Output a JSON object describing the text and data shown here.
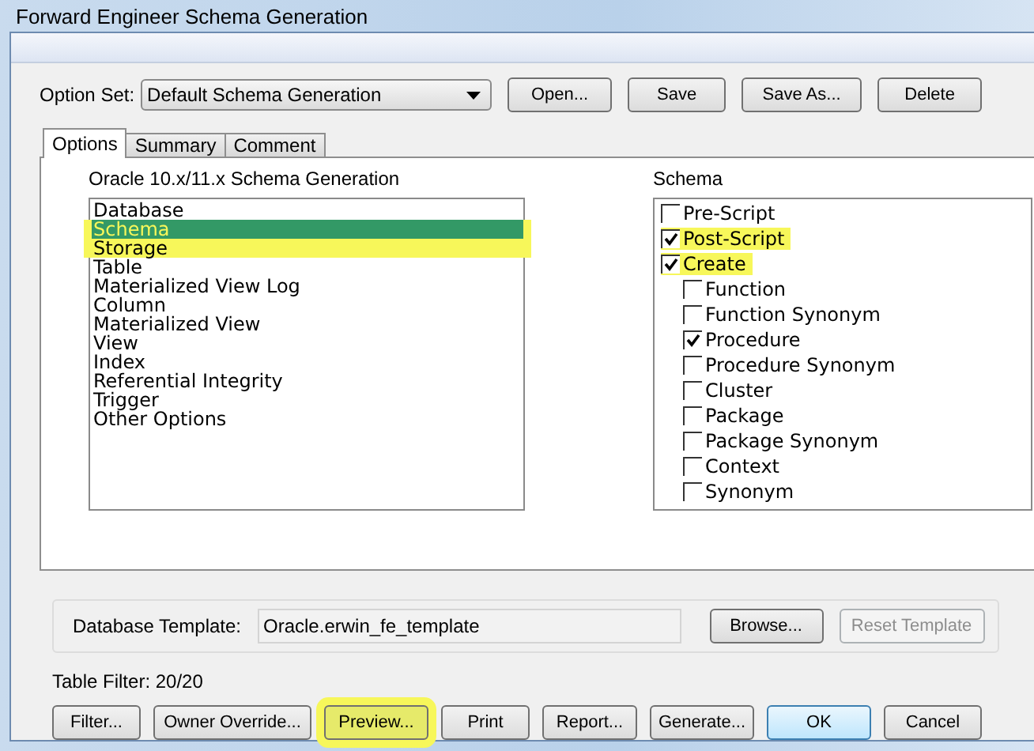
{
  "window": {
    "title": "Forward Engineer Schema Generation"
  },
  "option_set": {
    "label": "Option Set:",
    "value": "Default Schema Generation",
    "buttons": [
      "Open...",
      "Save",
      "Save As...",
      "Delete"
    ]
  },
  "tabs": [
    {
      "label": "Options",
      "selected": true
    },
    {
      "label": "Summary",
      "selected": false
    },
    {
      "label": "Comment",
      "selected": false
    }
  ],
  "categories": {
    "title": "Oracle 10.x/11.x Schema Generation",
    "items": [
      {
        "label": "Database",
        "selected": false,
        "highlighted": false
      },
      {
        "label": "Schema",
        "selected": true,
        "highlighted": true
      },
      {
        "label": "Storage",
        "selected": false,
        "highlighted": true
      },
      {
        "label": "Table",
        "selected": false,
        "highlighted": false
      },
      {
        "label": "Materialized View Log",
        "selected": false,
        "highlighted": false
      },
      {
        "label": "Column",
        "selected": false,
        "highlighted": false
      },
      {
        "label": "Materialized View",
        "selected": false,
        "highlighted": false
      },
      {
        "label": "View",
        "selected": false,
        "highlighted": false
      },
      {
        "label": "Index",
        "selected": false,
        "highlighted": false
      },
      {
        "label": "Referential Integrity",
        "selected": false,
        "highlighted": false
      },
      {
        "label": "Trigger",
        "selected": false,
        "highlighted": false
      },
      {
        "label": "Other Options",
        "selected": false,
        "highlighted": false
      }
    ]
  },
  "schema": {
    "title": "Schema",
    "items": [
      {
        "label": "Pre-Script",
        "checked": false,
        "highlighted": false
      },
      {
        "label": "Post-Script",
        "checked": true,
        "highlighted": true
      },
      {
        "label": "Create",
        "checked": true,
        "highlighted": true,
        "children": [
          {
            "label": "Function",
            "checked": false,
            "highlighted": false
          },
          {
            "label": "Function Synonym",
            "checked": false,
            "highlighted": false
          },
          {
            "label": "Procedure",
            "checked": true,
            "highlighted": false
          },
          {
            "label": "Procedure Synonym",
            "checked": false,
            "highlighted": false
          },
          {
            "label": "Cluster",
            "checked": false,
            "highlighted": false
          },
          {
            "label": "Package",
            "checked": false,
            "highlighted": false
          },
          {
            "label": "Package Synonym",
            "checked": false,
            "highlighted": false
          },
          {
            "label": "Context",
            "checked": false,
            "highlighted": false
          },
          {
            "label": "Synonym",
            "checked": false,
            "highlighted": false
          }
        ]
      }
    ]
  },
  "template": {
    "label": "Database Template:",
    "value": "Oracle.erwin_fe_template",
    "buttons": [
      {
        "label": "Browse...",
        "disabled": false
      },
      {
        "label": "Reset Template",
        "disabled": true
      }
    ]
  },
  "table_filter": "Table Filter: 20/20",
  "buttons": [
    {
      "label": "Filter...",
      "highlighted": false,
      "default": false
    },
    {
      "label": "Owner Override...",
      "highlighted": false,
      "default": false
    },
    {
      "label": "Preview...",
      "highlighted": true,
      "default": false
    },
    {
      "label": "Print",
      "highlighted": false,
      "default": false
    },
    {
      "label": "Report...",
      "highlighted": false,
      "default": false
    },
    {
      "label": "Generate...",
      "highlighted": false,
      "default": false
    },
    {
      "label": "OK",
      "highlighted": false,
      "default": true
    },
    {
      "label": "Cancel",
      "highlighted": false,
      "default": false
    }
  ]
}
